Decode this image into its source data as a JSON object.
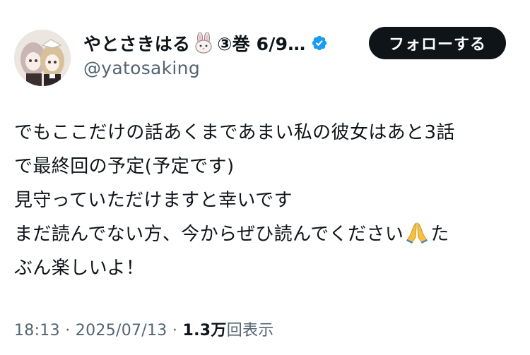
{
  "author": {
    "display_name": "やとさきはる",
    "name_suffix": "③巻 6/9…",
    "handle": "@yatosaking",
    "verified": true,
    "rabbit_icon": "rabbit-face-emoji",
    "verified_icon": "verified-badge-icon"
  },
  "follow_button": {
    "label": "フォローする"
  },
  "tweet": {
    "lines": [
      "でもここだけの話あくまであまい私の彼女はあと3話",
      "で最終回の予定(予定です)",
      "見守っていただけますと幸いです",
      "まだ読んでない方、今からぜひ読んでください",
      "た",
      "ぶん楽しいよ！"
    ],
    "emoji": "folded-hands-emoji"
  },
  "meta": {
    "time": "18:13",
    "separator1": " · ",
    "date": "2025/07/13",
    "separator2": " · ",
    "views_count": "1.3万",
    "views_label": "回表示"
  },
  "colors": {
    "text": "#0f1419",
    "secondary": "#536471",
    "verified": "#1d9bf0",
    "button_bg": "#0f1419",
    "button_text": "#ffffff"
  }
}
